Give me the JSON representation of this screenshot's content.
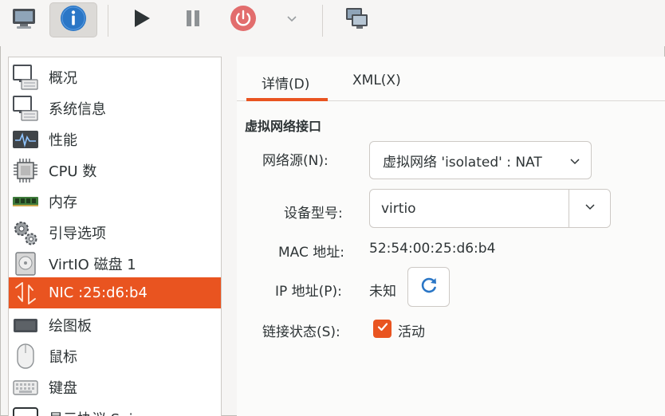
{
  "toolbar": {
    "buttons": [
      {
        "name": "console-view",
        "icon": "monitor-icon"
      },
      {
        "name": "details-view",
        "icon": "info-icon",
        "active": true
      },
      {
        "name": "run",
        "icon": "play-icon"
      },
      {
        "name": "pause",
        "icon": "pause-icon"
      },
      {
        "name": "shutdown",
        "icon": "power-icon"
      },
      {
        "name": "shutdown-menu",
        "icon": "chevron-down-icon"
      },
      {
        "name": "fullscreen",
        "icon": "screens-icon"
      }
    ],
    "accent_colors": {
      "info": "#2a76c6",
      "power": "#e26d6d"
    }
  },
  "sidebar": {
    "items": [
      {
        "label": "概况",
        "icon": "overview-monitor-icon"
      },
      {
        "label": "系统信息",
        "icon": "system-monitor-icon"
      },
      {
        "label": "性能",
        "icon": "performance-graph-icon"
      },
      {
        "label": "CPU 数",
        "icon": "cpu-chip-icon"
      },
      {
        "label": "内存",
        "icon": "memory-module-icon"
      },
      {
        "label": "引导选项",
        "icon": "gears-icon"
      },
      {
        "label": "VirtIO 磁盘 1",
        "icon": "disk-icon"
      },
      {
        "label": "NIC :25:d6:b4",
        "icon": "network-icon",
        "selected": true
      },
      {
        "label": "绘图板",
        "icon": "tablet-icon"
      },
      {
        "label": "鼠标",
        "icon": "mouse-icon"
      },
      {
        "label": "键盘",
        "icon": "keyboard-icon"
      },
      {
        "label": "显示协议 Spice",
        "icon": "display-icon"
      }
    ],
    "selected_color": "#e95420"
  },
  "tabs": [
    {
      "label": "详情(D)",
      "active": true
    },
    {
      "label": "XML(X)",
      "active": false
    }
  ],
  "nic": {
    "section_title": "虚拟网络接口",
    "network_source_label": "网络源(N):",
    "network_source_value": "虚拟网络 'isolated' : NAT",
    "device_model_label": "设备型号:",
    "device_model_value": "virtio",
    "mac_label": "MAC 地址:",
    "mac_value": "52:54:00:25:d6:b4",
    "ip_label": "IP 地址(P):",
    "ip_value": "未知",
    "link_state_label": "链接状态(S):",
    "link_state_checkbox_label": "活动",
    "link_state_checked": true
  }
}
